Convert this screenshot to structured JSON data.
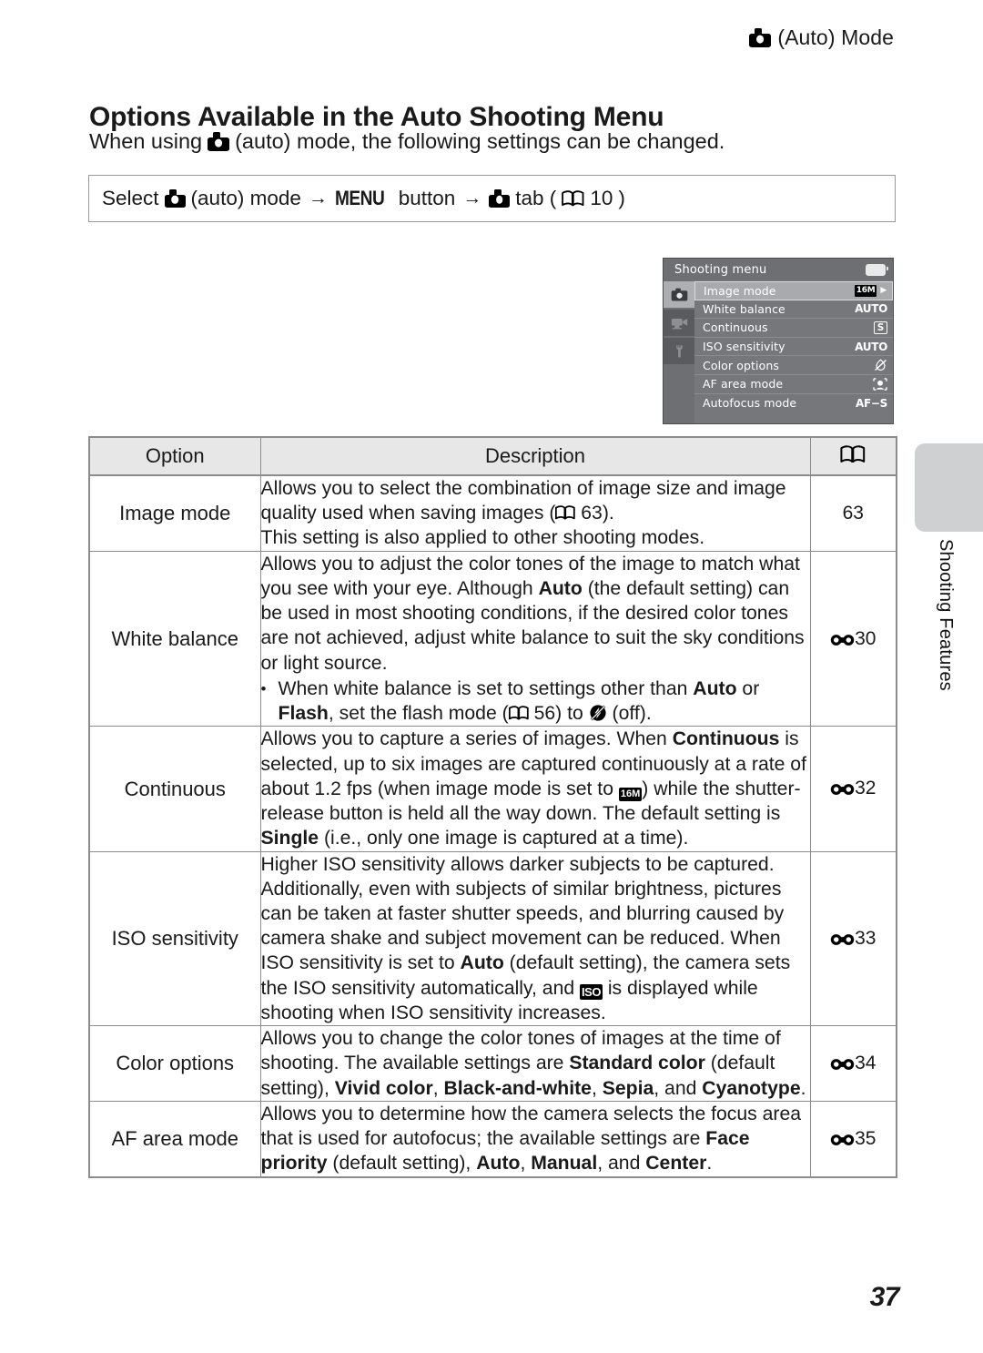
{
  "header": {
    "mode_icon": "camera-auto-icon",
    "text": "(Auto) Mode"
  },
  "title": "Options Available in the Auto Shooting Menu",
  "intro": {
    "before": "When using",
    "after": "(auto) mode, the following settings can be changed."
  },
  "nav_box": {
    "p1": "Select",
    "p2": "(auto) mode",
    "arrow1": "→",
    "menu_word": "MENU",
    "p3": "button",
    "arrow2": "→",
    "p4": "tab (",
    "page_ref": "10",
    "p5": ")"
  },
  "lcd": {
    "title": "Shooting menu",
    "battery_icon": "battery-icon",
    "tabs": [
      {
        "name": "shooting-tab",
        "icon": "camera-icon",
        "active": true
      },
      {
        "name": "movie-tab",
        "icon": "movie-camera-icon",
        "active": false
      },
      {
        "name": "setup-tab",
        "icon": "wrench-icon",
        "active": false
      }
    ],
    "rows": [
      {
        "label": "Image mode",
        "value": "16M",
        "value_kind": "black-badge",
        "selected": true
      },
      {
        "label": "White balance",
        "value": "AUTO",
        "value_kind": "text",
        "selected": false
      },
      {
        "label": "Continuous",
        "value": "S",
        "value_kind": "boxed",
        "selected": false
      },
      {
        "label": "ISO sensitivity",
        "value": "AUTO",
        "value_kind": "text",
        "selected": false
      },
      {
        "label": "Color options",
        "value": "color-off-icon",
        "value_kind": "icon",
        "selected": false
      },
      {
        "label": "AF area mode",
        "value": "face-priority-icon",
        "value_kind": "icon",
        "selected": false
      },
      {
        "label": "Autofocus mode",
        "value": "AF−S",
        "value_kind": "text",
        "selected": false
      }
    ]
  },
  "table": {
    "headers": {
      "option": "Option",
      "description": "Description",
      "reference": "book-icon"
    },
    "rows": [
      {
        "option": "Image mode",
        "reference": "63",
        "reference_kind": "plain"
      },
      {
        "option": "White balance",
        "reference": "30",
        "reference_kind": "e-symbol"
      },
      {
        "option": "Continuous",
        "reference": "32",
        "reference_kind": "e-symbol"
      },
      {
        "option": "ISO sensitivity",
        "reference": "33",
        "reference_kind": "e-symbol"
      },
      {
        "option": "Color options",
        "reference": "34",
        "reference_kind": "e-symbol"
      },
      {
        "option": "AF area mode",
        "reference": "35",
        "reference_kind": "e-symbol"
      }
    ],
    "descriptions": {
      "image_mode_l1": "Allows you to select the combination of image size and image",
      "image_mode_l2a": "quality used when saving images (",
      "image_mode_l2b": "63).",
      "image_mode_l3": "This setting is also applied to other shooting modes.",
      "white_balance_p1": "Allows you to adjust the color tones of the image to match what you see with your eye. Although ",
      "white_balance_b1": "Auto",
      "white_balance_p2": " (the default setting) can be used in most shooting conditions, if the desired color tones are not achieved, adjust white balance to suit the sky conditions or light source.",
      "white_balance_bullet_p1": "When white balance is set to settings other than ",
      "white_balance_bullet_b1": "Auto",
      "white_balance_bullet_p2": " or ",
      "white_balance_bullet_b2": "Flash",
      "white_balance_bullet_p3": ", set the flash mode (",
      "white_balance_bullet_pg": "56",
      "white_balance_bullet_p4": ") to ",
      "white_balance_bullet_p5": " (off).",
      "continuous_p1": "Allows you to capture a series of images. When ",
      "continuous_b1": "Continuous",
      "continuous_p2": " is selected, up to six images are captured continuously at a rate of about 1.2 fps (when image mode is set to ",
      "continuous_badge": "16M",
      "continuous_p3": ") while the shutter-release button is held all the way down. The default setting is ",
      "continuous_b2": "Single",
      "continuous_p4": " (i.e., only one image is captured at a time).",
      "iso_p1": "Higher ISO sensitivity allows darker subjects to be captured. Additionally, even with subjects of similar brightness, pictures can be taken at faster shutter speeds, and blurring caused by camera shake and subject movement can be reduced. When ISO sensitivity is set to ",
      "iso_b1": "Auto",
      "iso_p2": " (default setting), the camera sets the ISO sensitivity automatically, and ",
      "iso_badge": "ISO",
      "iso_p3": " is displayed while shooting when ISO sensitivity increases.",
      "color_p1": "Allows you to change the color tones of images at the time of shooting. The available settings are ",
      "color_b1": "Standard color",
      "color_p2": " (default setting), ",
      "color_b2": "Vivid color",
      "color_p3": ", ",
      "color_b3": "Black-and-white",
      "color_p4": ", ",
      "color_b4": "Sepia",
      "color_p5": ", and ",
      "color_b5": "Cyanotype",
      "color_p6": ".",
      "af_p1": "Allows you to determine how the camera selects the focus area that is used for autofocus; the available settings are ",
      "af_b1": "Face priority",
      "af_p2": " (default setting), ",
      "af_b2": "Auto",
      "af_p3": ", ",
      "af_b3": "Manual",
      "af_p4": ", and ",
      "af_b4": "Center",
      "af_p5": "."
    }
  },
  "chapter_tab_label": "Shooting Features",
  "folio": "37"
}
